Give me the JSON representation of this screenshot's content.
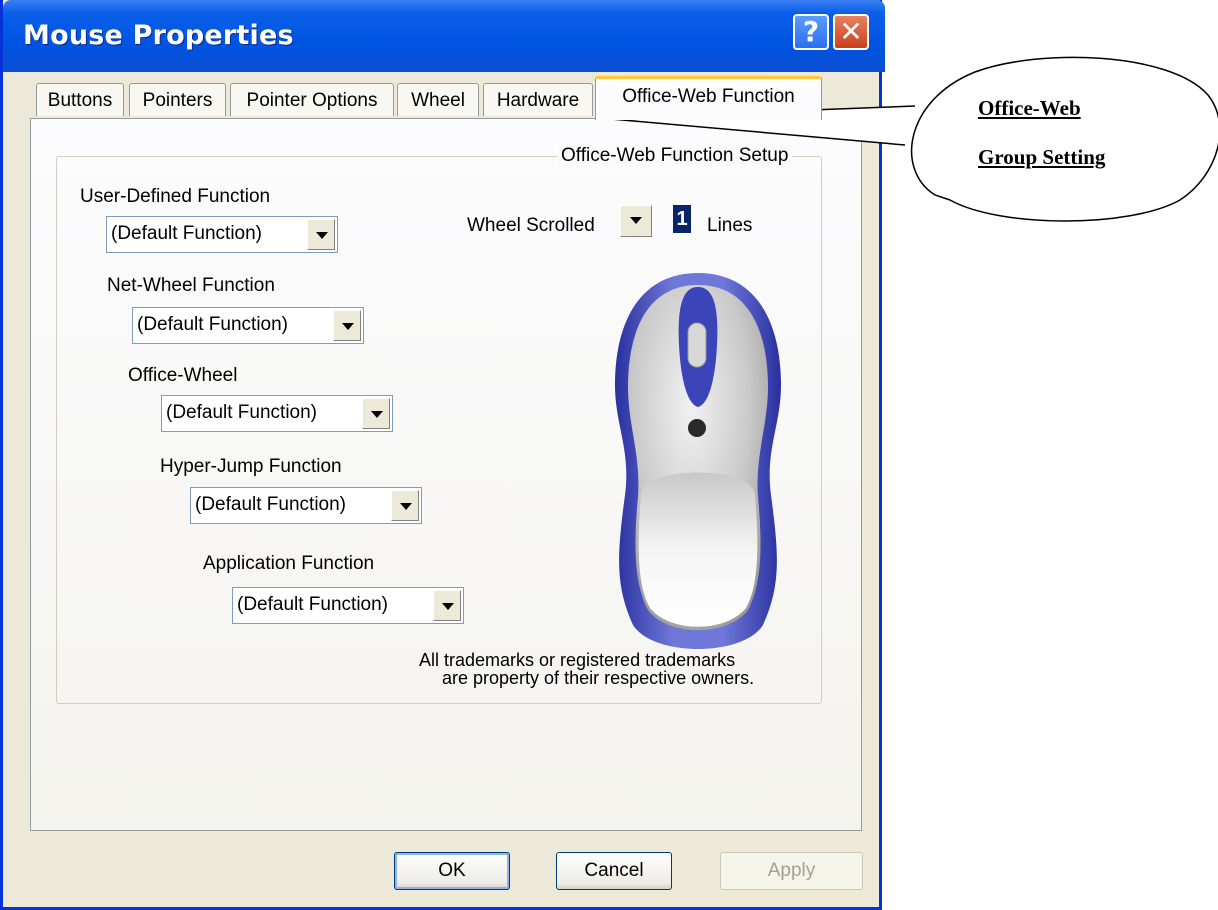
{
  "window": {
    "title": "Mouse Properties",
    "help_label": "?",
    "close_label": "✕"
  },
  "tabs": [
    {
      "label": "Buttons"
    },
    {
      "label": "Pointers"
    },
    {
      "label": "Pointer Options"
    },
    {
      "label": "Wheel"
    },
    {
      "label": "Hardware"
    },
    {
      "label": "Office-Web Function",
      "active": true
    }
  ],
  "group": {
    "legend": "Office-Web Function Setup",
    "user_defined": {
      "label": "User-Defined Function",
      "value": "(Default Function)"
    },
    "net_wheel": {
      "label": "Net-Wheel Function",
      "value": "(Default Function)"
    },
    "office_wheel": {
      "label": "Office-Wheel",
      "value": "(Default Function)"
    },
    "hyper_jump": {
      "label": "Hyper-Jump Function",
      "value": "(Default Function)"
    },
    "application": {
      "label": "Application Function",
      "value": "(Default Function)"
    },
    "wheel_scrolled": {
      "prefix": "Wheel Scrolled",
      "value": "1",
      "suffix": "Lines"
    },
    "trademark_line1": "All trademarks or registered trademarks",
    "trademark_line2": "are property of their respective owners."
  },
  "buttons": {
    "ok": "OK",
    "cancel": "Cancel",
    "apply": "Apply"
  },
  "callout": {
    "line1": "Office-Web",
    "line2": "Group Setting"
  }
}
